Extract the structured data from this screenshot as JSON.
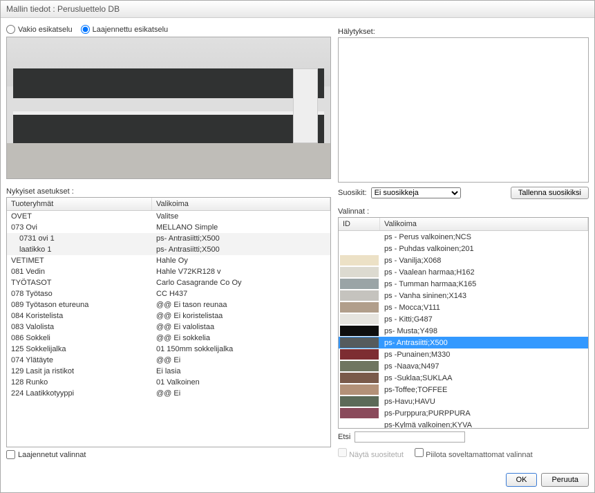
{
  "window_title": "Mallin tiedot : Perusluettelo DB",
  "preview": {
    "standard_label": "Vakio esikatselu",
    "extended_label": "Laajennettu esikatselu",
    "selected": "extended"
  },
  "alerts_label": "Hälytykset:",
  "favorites": {
    "label": "Suosikit:",
    "selected": "Ei suosikkeja",
    "save_button": "Tallenna suosikiksi"
  },
  "current_settings": {
    "label": "Nykyiset asetukset :",
    "col1": "Tuoteryhmät",
    "col2": "Valikoima",
    "rows": [
      {
        "c1": "OVET",
        "c2": "Valitse",
        "indent": 0
      },
      {
        "c1": "073 Ovi",
        "c2": "MELLANO Simple",
        "indent": 0
      },
      {
        "c1": "0731 ovi 1",
        "c2": "ps- Antrasiitti;X500",
        "indent": 1,
        "hl": true
      },
      {
        "c1": "laatikko 1",
        "c2": "ps- Antrasiitti;X500",
        "indent": 1,
        "hl": true
      },
      {
        "c1": "VETIMET",
        "c2": "Hahle Oy",
        "indent": 0
      },
      {
        "c1": "081 Vedin",
        "c2": "Hahle V72KR128 v",
        "indent": 0
      },
      {
        "c1": "TYÖTASOT",
        "c2": "Carlo Casagrande Co Oy",
        "indent": 0
      },
      {
        "c1": "078 Työtaso",
        "c2": "CC H437",
        "indent": 0
      },
      {
        "c1": "089 Työtason etureuna",
        "c2": "@@ Ei tason reunaa",
        "indent": 0
      },
      {
        "c1": "084 Koristelista",
        "c2": "@@ Ei koristelistaa",
        "indent": 0
      },
      {
        "c1": "083 Valolista",
        "c2": "@@ Ei valolistaa",
        "indent": 0
      },
      {
        "c1": "086 Sokkeli",
        "c2": "@@ Ei sokkelia",
        "indent": 0
      },
      {
        "c1": "125 Sokkelijalka",
        "c2": "01 150mm sokkelijalka",
        "indent": 0
      },
      {
        "c1": "074 Ylätäyte",
        "c2": "@@ Ei",
        "indent": 0
      },
      {
        "c1": "129 Lasit ja ristikot",
        "c2": "Ei lasia",
        "indent": 0
      },
      {
        "c1": "128 Runko",
        "c2": "01 Valkoinen",
        "indent": 0
      },
      {
        "c1": "224 Laatikkotyyppi",
        "c2": "@@ Ei",
        "indent": 0
      }
    ],
    "extended_checkbox": "Laajennetut valinnat"
  },
  "selections": {
    "label": "Valinnat :",
    "col1": "ID",
    "col2": "Valikoima",
    "rows": [
      {
        "color": "#ffffff",
        "label": "ps - Perus valkoinen;NCS"
      },
      {
        "color": "#ffffff",
        "label": "ps - Puhdas valkoinen;201"
      },
      {
        "color": "#ece1c6",
        "label": "ps - Vanilja;X068"
      },
      {
        "color": "#dcdad0",
        "label": "ps - Vaalean harmaa;H162"
      },
      {
        "color": "#9aa4a6",
        "label": "ps - Tumman harmaa;K165"
      },
      {
        "color": "#c5c3be",
        "label": "ps - Vanha sininen;X143"
      },
      {
        "color": "#b19e8b",
        "label": "ps - Mocca;V111"
      },
      {
        "color": "#e6e4df",
        "label": "ps - Kitti;G487"
      },
      {
        "color": "#0e0e0e",
        "label": "ps-  Musta;Y498"
      },
      {
        "color": "#555b5d",
        "label": "ps- Antrasiitti;X500",
        "selected": true
      },
      {
        "color": "#7d2d32",
        "label": "ps -Punainen;M330"
      },
      {
        "color": "#6f7660",
        "label": "ps -Naava;N497"
      },
      {
        "color": "#7a5a4a",
        "label": "ps -Suklaa;SUKLAA"
      },
      {
        "color": "#b39178",
        "label": "ps-Toffee;TOFFEE"
      },
      {
        "color": "#5c6a58",
        "label": "ps-Havu;HAVU"
      },
      {
        "color": "#8a4a5b",
        "label": "ps-Purppura;PURPPURA"
      },
      {
        "color": "#ffffff",
        "label": "ps-Kylmä valkoinen;KYVA"
      }
    ],
    "search_label": "Etsi",
    "show_favorites": "Näytä suositetut",
    "hide_unsuitable": "Piilota soveltamattomat valinnat"
  },
  "buttons": {
    "ok": "OK",
    "cancel": "Peruuta"
  }
}
